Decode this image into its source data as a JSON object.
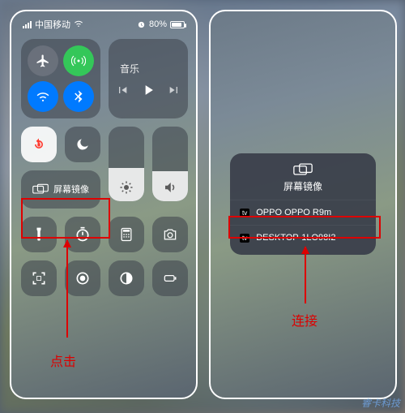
{
  "status": {
    "carrier": "中国移动",
    "battery_pct": "80%"
  },
  "cc": {
    "music_label": "音乐",
    "mirror_label": "屏幕镜像",
    "brightness_pct": 45,
    "volume_pct": 40
  },
  "icons": {
    "airplane": "airplane-icon",
    "cellular": "cellular-icon",
    "wifi": "wifi-icon",
    "bluetooth": "bluetooth-icon",
    "lock_rotation": "rotation-lock-icon",
    "dnd": "moon-icon",
    "flashlight": "flashlight-icon",
    "timer": "timer-icon",
    "calculator": "calculator-icon",
    "camera": "camera-icon",
    "qr": "qr-scan-icon",
    "record": "screen-record-icon",
    "accessibility": "dark-mode-icon",
    "lowpower": "battery-icon"
  },
  "callouts": {
    "left_label": "点击",
    "right_label": "连接"
  },
  "popup": {
    "title": "屏幕镜像",
    "devices": [
      {
        "badge": "tv",
        "name": "OPPO OPPO R9m"
      },
      {
        "badge": "tv",
        "name": "DESKTOP-1LO98I2"
      }
    ]
  },
  "watermark": "睿卡科技"
}
